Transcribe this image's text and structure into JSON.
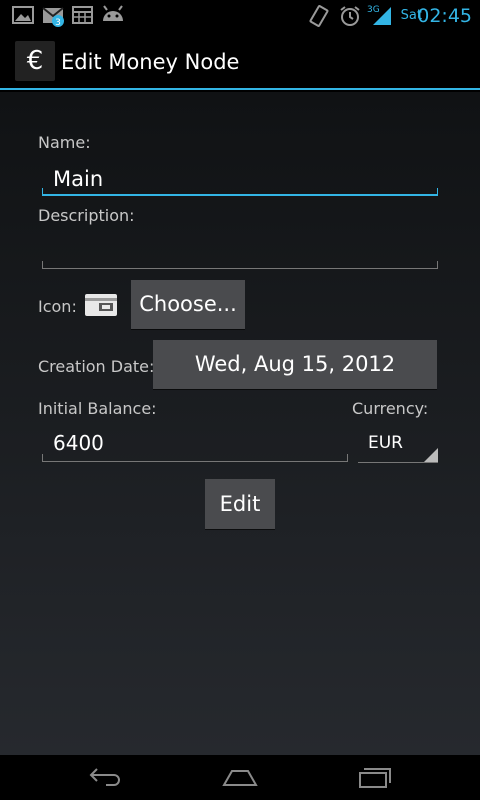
{
  "status_bar": {
    "day": "Sat",
    "time": "02:45",
    "network": "3G",
    "accent_color": "#33b5e5",
    "icons": [
      "gallery-icon",
      "gmail-icon",
      "calendar-icon",
      "android-icon",
      "rotation-icon",
      "alarm-icon",
      "signal-icon"
    ],
    "gmail_badge": "3"
  },
  "action_bar": {
    "icon_glyph": "€",
    "title": "Edit Money Node"
  },
  "form": {
    "name_label": "Name:",
    "name_value": "Main",
    "description_label": "Description:",
    "description_value": "",
    "icon_label": "Icon:",
    "choose_button": "Choose...",
    "creation_date_label": "Creation Date:",
    "creation_date_value": "Wed, Aug 15, 2012",
    "initial_balance_label": "Initial Balance:",
    "initial_balance_value": "6400",
    "currency_label": "Currency:",
    "currency_value": "EUR",
    "edit_button": "Edit"
  },
  "nav_bar": {
    "buttons": [
      "back-icon",
      "home-icon",
      "recent-apps-icon"
    ]
  }
}
